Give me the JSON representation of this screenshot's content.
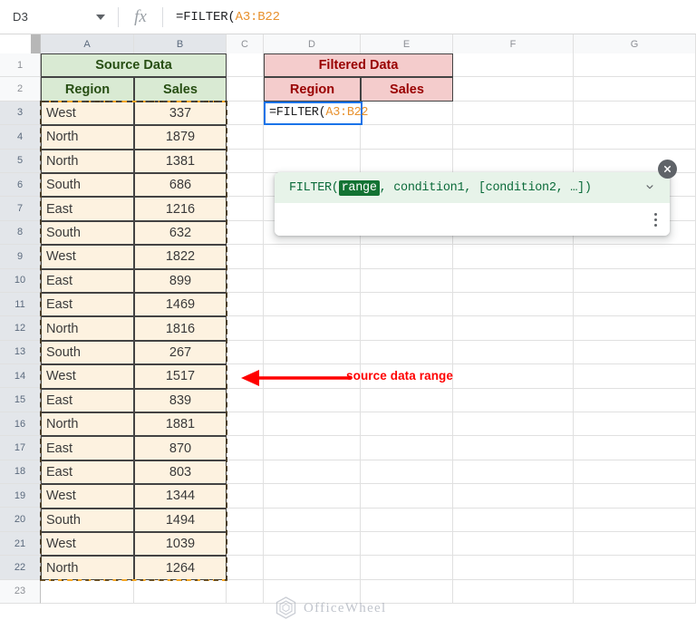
{
  "formula_bar": {
    "name_box_value": "D3",
    "fx_label": "fx",
    "formula_prefix": "=FILTER(",
    "formula_ref": "A3:B22"
  },
  "grid": {
    "columns": [
      "A",
      "B",
      "C",
      "D",
      "E",
      "F",
      "G"
    ],
    "selected_columns": [
      "A",
      "B"
    ],
    "rows": [
      1,
      2,
      3,
      4,
      5,
      6,
      7,
      8,
      9,
      10,
      11,
      12,
      13,
      14,
      15,
      16,
      17,
      18,
      19,
      20,
      21,
      22,
      23
    ],
    "selected_rows": [
      3,
      4,
      5,
      6,
      7,
      8,
      9,
      10,
      11,
      12,
      13,
      14,
      15,
      16,
      17,
      18,
      19,
      20,
      21,
      22
    ]
  },
  "source_table": {
    "title": "Source Data",
    "headers": [
      "Region",
      "Sales"
    ],
    "rows": [
      [
        "West",
        "337"
      ],
      [
        "North",
        "1879"
      ],
      [
        "North",
        "1381"
      ],
      [
        "South",
        "686"
      ],
      [
        "East",
        "1216"
      ],
      [
        "South",
        "632"
      ],
      [
        "West",
        "1822"
      ],
      [
        "East",
        "899"
      ],
      [
        "East",
        "1469"
      ],
      [
        "North",
        "1816"
      ],
      [
        "South",
        "267"
      ],
      [
        "West",
        "1517"
      ],
      [
        "East",
        "839"
      ],
      [
        "North",
        "1881"
      ],
      [
        "East",
        "870"
      ],
      [
        "East",
        "803"
      ],
      [
        "West",
        "1344"
      ],
      [
        "South",
        "1494"
      ],
      [
        "West",
        "1039"
      ],
      [
        "North",
        "1264"
      ]
    ],
    "header_bg": "#d9ead3",
    "header_text": "#274e13",
    "body_bg": "#fdf2e0"
  },
  "filtered_table": {
    "title": "Filtered Data",
    "headers": [
      "Region",
      "Sales"
    ],
    "header_bg": "#f4cccc",
    "header_text": "#990000"
  },
  "active_cell": {
    "ref": "D3",
    "text_prefix": "=FILTER(",
    "text_ref": "A3:B22",
    "border_color": "#1a73e8"
  },
  "formula_help": {
    "signature_prefix": "FILTER(",
    "active_arg": "range",
    "signature_suffix": ", condition1, [condition2, …])",
    "chevron": "chevron-down",
    "close": "close",
    "more": "more-options",
    "bg": "#e7f3e9",
    "arg_bg": "#137333"
  },
  "annotation": {
    "label": "source data range",
    "color": "#ff0000"
  },
  "watermark": {
    "text": "OfficeWheel"
  }
}
